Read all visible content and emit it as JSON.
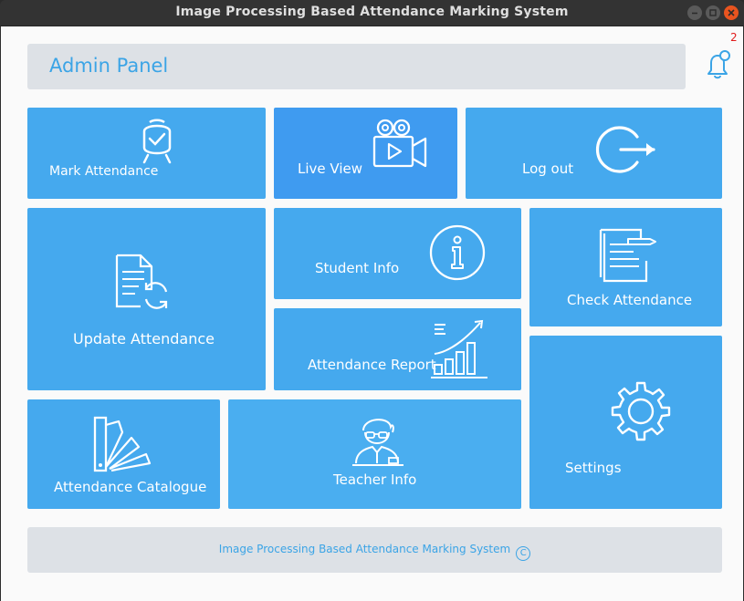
{
  "window": {
    "title": "Image Processing Based Attendance Marking System"
  },
  "header": {
    "title": "Admin Panel",
    "notification_count": "2"
  },
  "tiles": {
    "mark_attendance": "Mark Attendance",
    "live_view": "Live View",
    "log_out": "Log out",
    "update_attendance": "Update Attendance",
    "student_info": "Student Info",
    "check_attendance": "Check Attendance",
    "attendance_report": "Attendance Report",
    "attendance_catalogue": "Attendance Catalogue",
    "teacher_info": "Teacher Info",
    "settings": "Settings"
  },
  "footer": {
    "text": "Image Processing Based Attendance Marking System",
    "copyright_symbol": "C"
  },
  "colors": {
    "tile": "#45a9ee",
    "tile_dark": "#3f9bf0",
    "accent_text": "#3ba4e6",
    "panel": "#dde1e6",
    "badge": "#e01b1b"
  }
}
